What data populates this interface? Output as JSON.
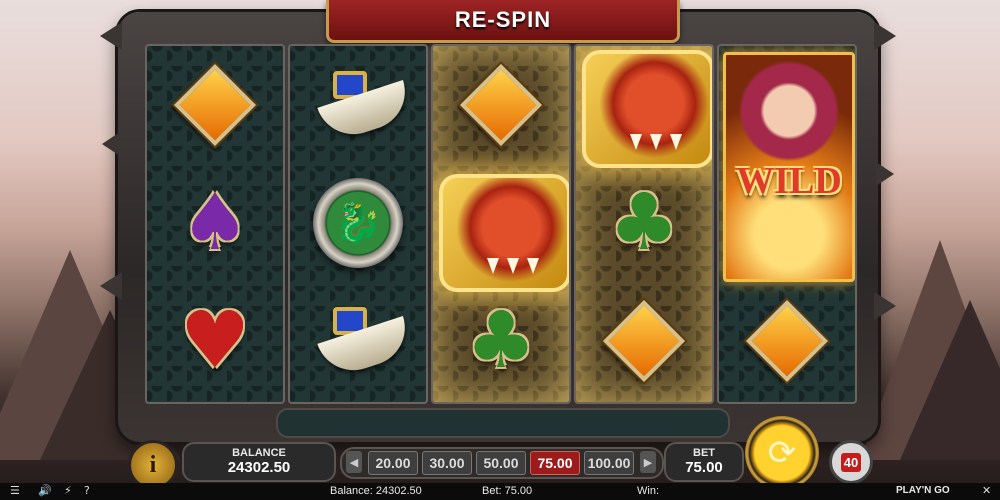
{
  "banner": {
    "text": "RE-SPIN"
  },
  "reels": [
    {
      "symbols": [
        "orange-diamond",
        "purple-spade",
        "red-heart"
      ],
      "spade": "♠",
      "heart": "♥"
    },
    {
      "symbols": [
        "dagger",
        "dragon-coin",
        "dagger"
      ],
      "coin": "🐉"
    },
    {
      "symbols": [
        "orange-diamond",
        "red-dragon",
        "green-club"
      ],
      "club": "♣"
    },
    {
      "symbols": [
        "red-dragon",
        "green-club",
        "orange-diamond"
      ],
      "club": "♣"
    },
    {
      "symbols": [
        "wild",
        "orange-diamond"
      ],
      "wild_label": "WILD"
    }
  ],
  "controls": {
    "info_label": "i",
    "balance_label": "BALANCE",
    "balance_value": "24302.50",
    "bet_options": [
      "20.00",
      "30.00",
      "50.00",
      "75.00",
      "100.00"
    ],
    "selected_bet": "75.00",
    "bet_label": "BET",
    "bet_value": "75.00",
    "autoplay_value": "40"
  },
  "statusbar": {
    "balance": "Balance: 24302.50",
    "bet": "Bet: 75.00",
    "win": "Win:",
    "brand": "PLAY'N GO"
  },
  "colors": {
    "accent_red": "#9c1c1c",
    "gold": "#e2b23a",
    "reel_bg": "#223735"
  }
}
